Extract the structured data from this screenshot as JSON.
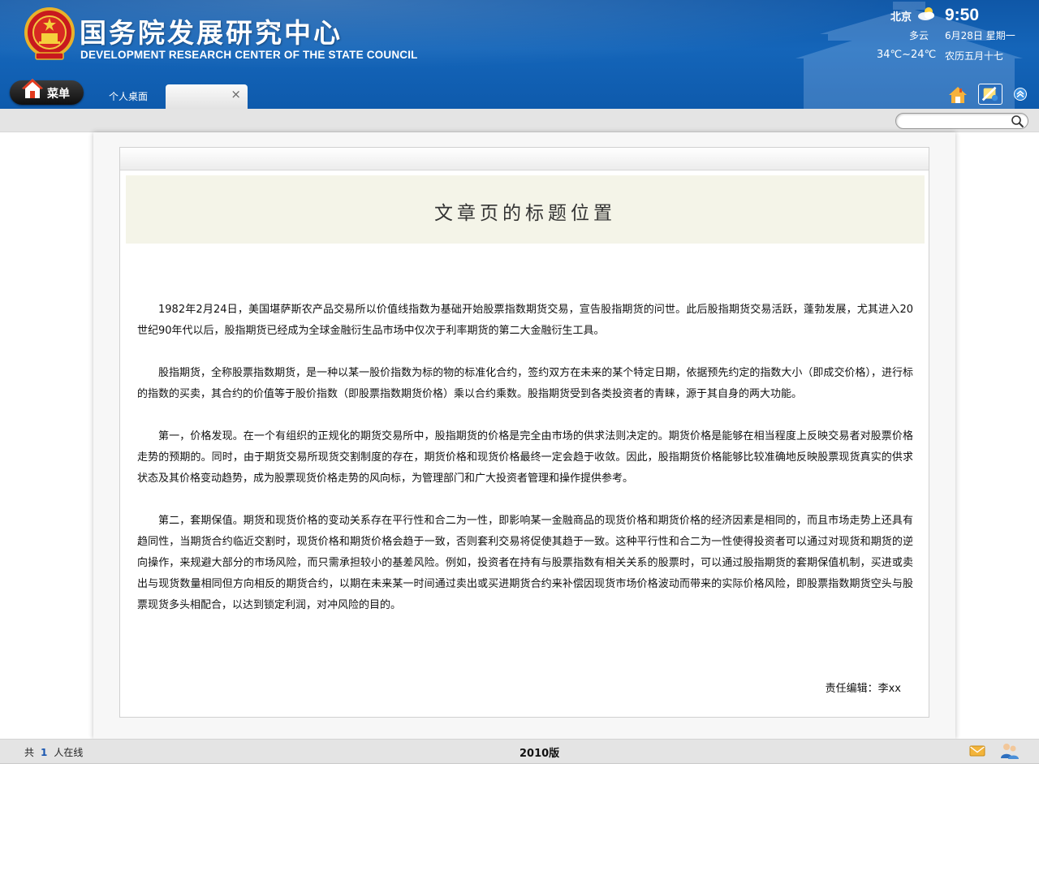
{
  "header": {
    "title_cn": "国务院发展研究中心",
    "title_en": "DEVELOPMENT RESEARCH CENTER OF THE STATE COUNCIL"
  },
  "weather": {
    "city": "北京",
    "time": "9:50",
    "condition": "多云",
    "date": "6月28日 星期一",
    "temperature": "34℃~24℃",
    "lunar": "农历五月十七"
  },
  "nav": {
    "menu_label": "菜单",
    "tabs": [
      {
        "label": "个人桌面"
      },
      {
        "label": ""
      }
    ],
    "close_symbol": "×"
  },
  "search": {
    "placeholder": ""
  },
  "article": {
    "title": "文章页的标题位置",
    "paragraphs": [
      "1982年2月24日，美国堪萨斯农产品交易所以价值线指数为基础开始股票指数期货交易，宣告股指期货的问世。此后股指期货交易活跃，蓬勃发展，尤其进入20世纪90年代以后，股指期货已经成为全球金融衍生品市场中仅次于利率期货的第二大金融衍生工具。",
      "股指期货，全称股票指数期货，是一种以某一股价指数为标的物的标准化合约，签约双方在未来的某个特定日期，依据预先约定的指数大小（即成交价格），进行标的指数的买卖，其合约的价值等于股价指数（即股票指数期货价格）乘以合约乘数。股指期货受到各类投资者的青睐，源于其自身的两大功能。",
      "第一，价格发现。在一个有组织的正规化的期货交易所中，股指期货的价格是完全由市场的供求法则决定的。期货价格是能够在相当程度上反映交易者对股票价格走势的预期的。同时，由于期货交易所现货交割制度的存在，期货价格和现货价格最终一定会趋于收敛。因此，股指期货价格能够比较准确地反映股票现货真实的供求状态及其价格变动趋势，成为股票现货价格走势的风向标，为管理部门和广大投资者管理和操作提供参考。",
      "第二，套期保值。期货和现货价格的变动关系存在平行性和合二为一性，即影响某一金融商品的现货价格和期货价格的经济因素是相同的，而且市场走势上还具有趋同性，当期货合约临近交割时，现货价格和期货价格会趋于一致，否则套利交易将促使其趋于一致。这种平行性和合二为一性使得投资者可以通过对现货和期货的逆向操作，来规避大部分的市场风险，而只需承担较小的基差风险。例如，投资者在持有与股票指数有相关关系的股票时，可以通过股指期货的套期保值机制，买进或卖出与现货数量相同但方向相反的期货合约，以期在未来某一时间通过卖出或买进期货合约来补偿因现货市场价格波动而带来的实际价格风险，即股票指数期货空头与股票现货多头相配合，以达到锁定利润，对冲风险的目的。"
    ],
    "editor": "责任编辑：李xx"
  },
  "footer": {
    "online_prefix": "共",
    "online_count": "1",
    "online_suffix": "人在线",
    "version": "2010版"
  },
  "icons": {
    "emblem": "national-emblem-icon",
    "weather": "partly-cloudy-icon",
    "menu": "home-icon",
    "home": "home-icon",
    "skin": "skin-icon",
    "collapse": "collapse-up-icon",
    "search": "search-icon",
    "mail": "mail-icon",
    "users": "online-users-icon"
  },
  "colors": {
    "header_blue": "#1465b9",
    "title_bg": "#f4f4e8",
    "toolbar_gray": "#e4e4e4"
  }
}
